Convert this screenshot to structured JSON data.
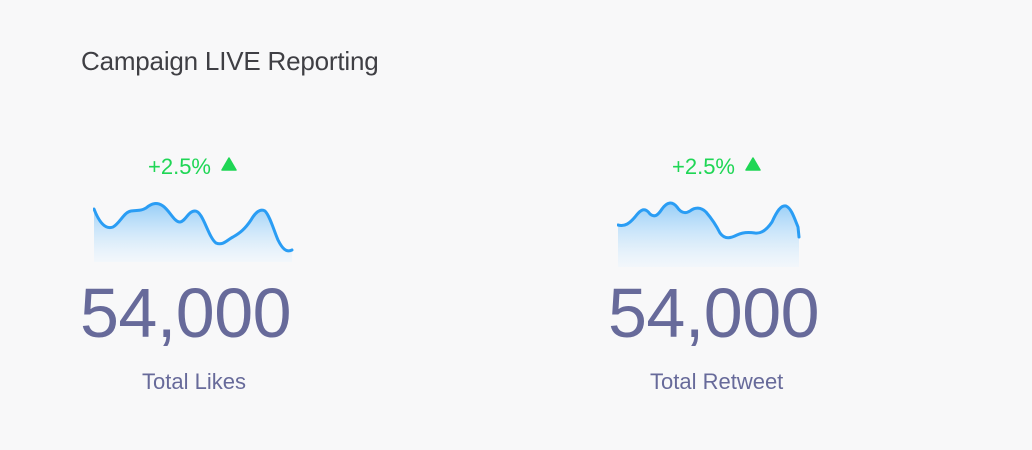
{
  "header": {
    "title": "Campaign LIVE Reporting"
  },
  "colors": {
    "accent_green": "#1fd655",
    "value_color": "#676a9a",
    "spark_line": "#2a9df4",
    "spark_fill": "#bfe3fb"
  },
  "cards": [
    {
      "delta": "+2.5%",
      "trend_icon": "triangle-up-icon",
      "value": "54,000",
      "label": "Total Likes"
    },
    {
      "delta": "+2.5%",
      "trend_icon": "triangle-up-icon",
      "value": "54,000",
      "label": "Total Retweet"
    }
  ]
}
